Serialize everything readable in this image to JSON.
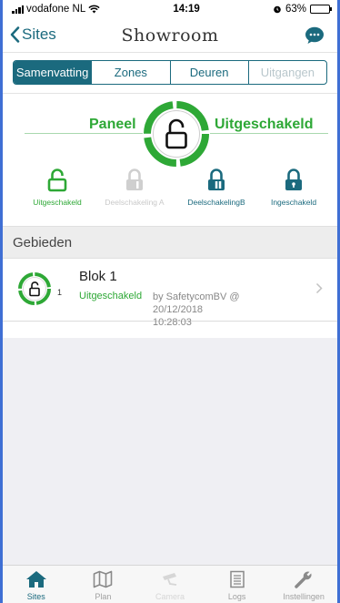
{
  "status_bar": {
    "carrier": "vodafone NL",
    "time": "14:19",
    "battery_pct": "63%",
    "battery_level": 0.63
  },
  "nav": {
    "back_label": "Sites",
    "title": "Showroom"
  },
  "segments": [
    {
      "label": "Samenvatting",
      "state": "active"
    },
    {
      "label": "Zones",
      "state": "normal"
    },
    {
      "label": "Deuren",
      "state": "normal"
    },
    {
      "label": "Uitgangen",
      "state": "disabled"
    }
  ],
  "panel": {
    "left_label": "Paneel",
    "right_label": "Uitgeschakeld",
    "status_color": "#2ea836"
  },
  "modes": [
    {
      "label": "Uitgeschakeld",
      "color": "#2ea836"
    },
    {
      "label": "Deelschakeling A",
      "color": "#c9c9c9"
    },
    {
      "label": "DeelschakelingB",
      "color": "#1b6a7e"
    },
    {
      "label": "Ingeschakeld",
      "color": "#1b6a7e"
    }
  ],
  "section_title": "Gebieden",
  "areas": [
    {
      "name": "Blok 1",
      "number": "1",
      "status": "Uitgeschakeld",
      "by_line1": "by SafetycomBV @ 20/12/2018",
      "by_line2": "10:28:03"
    }
  ],
  "tabs": [
    {
      "label": "Sites",
      "icon": "home-icon",
      "state": "active"
    },
    {
      "label": "Plan",
      "icon": "map-icon",
      "state": "normal"
    },
    {
      "label": "Camera",
      "icon": "camera-icon",
      "state": "dim"
    },
    {
      "label": "Logs",
      "icon": "log-icon",
      "state": "normal"
    },
    {
      "label": "Instellingen",
      "icon": "wrench-icon",
      "state": "normal"
    }
  ],
  "colors": {
    "accent": "#1b6a7e",
    "success": "#2ea836"
  }
}
